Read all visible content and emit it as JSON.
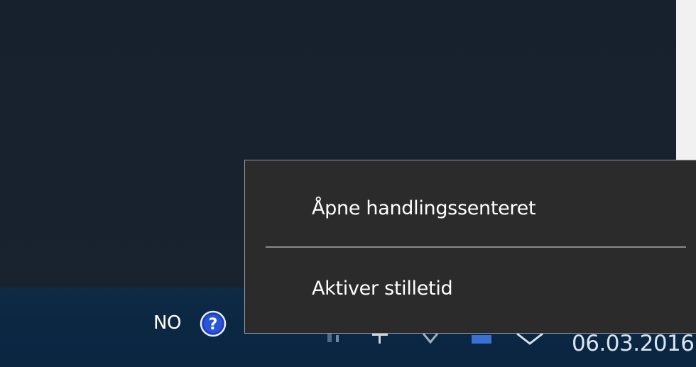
{
  "context_menu": {
    "items": [
      {
        "label": "Åpne handlingssenteret"
      },
      {
        "label": "Aktiver stilletid"
      }
    ]
  },
  "taskbar": {
    "language": "NO",
    "date": "06.03.2016",
    "icons": [
      "help-icon",
      "network-icon",
      "volume-icon",
      "battery-icon",
      "notification-icon"
    ]
  },
  "colors": {
    "menu_background": "#2b2b2b",
    "taskbar": "#0b2742",
    "desktop": "#18222f"
  }
}
